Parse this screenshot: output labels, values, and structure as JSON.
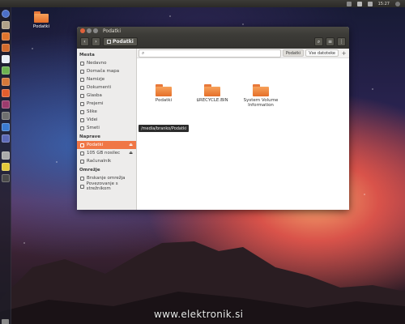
{
  "top_panel": {
    "indicators": [
      "mail-icon",
      "battery-icon",
      "volume-icon"
    ],
    "time": "15:27"
  },
  "desktop": {
    "icon_label": "Podatki",
    "watermark": "www.elektronik.si"
  },
  "window": {
    "title": "Podatki",
    "path_button": "Podatki",
    "search": {
      "value": "",
      "placeholder": ""
    },
    "scopes": [
      "Podatki",
      "Vse datoteke"
    ],
    "tooltip": "/media/branko/Podatki",
    "sidebar": {
      "sections": [
        {
          "title": "Mesta",
          "items": [
            {
              "label": "Nedavno"
            },
            {
              "label": "Domača mapa"
            },
            {
              "label": "Namizje"
            },
            {
              "label": "Dokumenti"
            },
            {
              "label": "Glasba"
            },
            {
              "label": "Prejemi"
            },
            {
              "label": "Slike"
            },
            {
              "label": "Videi"
            },
            {
              "label": "Smeti"
            }
          ]
        },
        {
          "title": "Naprave",
          "items": [
            {
              "label": "Podatki",
              "active": true
            },
            {
              "label": "105 GB nosilec"
            },
            {
              "label": "Računalnik"
            }
          ]
        },
        {
          "title": "Omrežje",
          "items": [
            {
              "label": "Brskanje omrežja"
            },
            {
              "label": "Povezovanje s strežnikom"
            }
          ]
        }
      ]
    },
    "files": [
      {
        "name": "Podatki"
      },
      {
        "name": "$RECYCLE.BIN"
      },
      {
        "name": "System Volume Information"
      }
    ]
  },
  "colors": {
    "accent": "#f07746",
    "folder": "#f49a4f",
    "panel": "#3c3b37"
  }
}
